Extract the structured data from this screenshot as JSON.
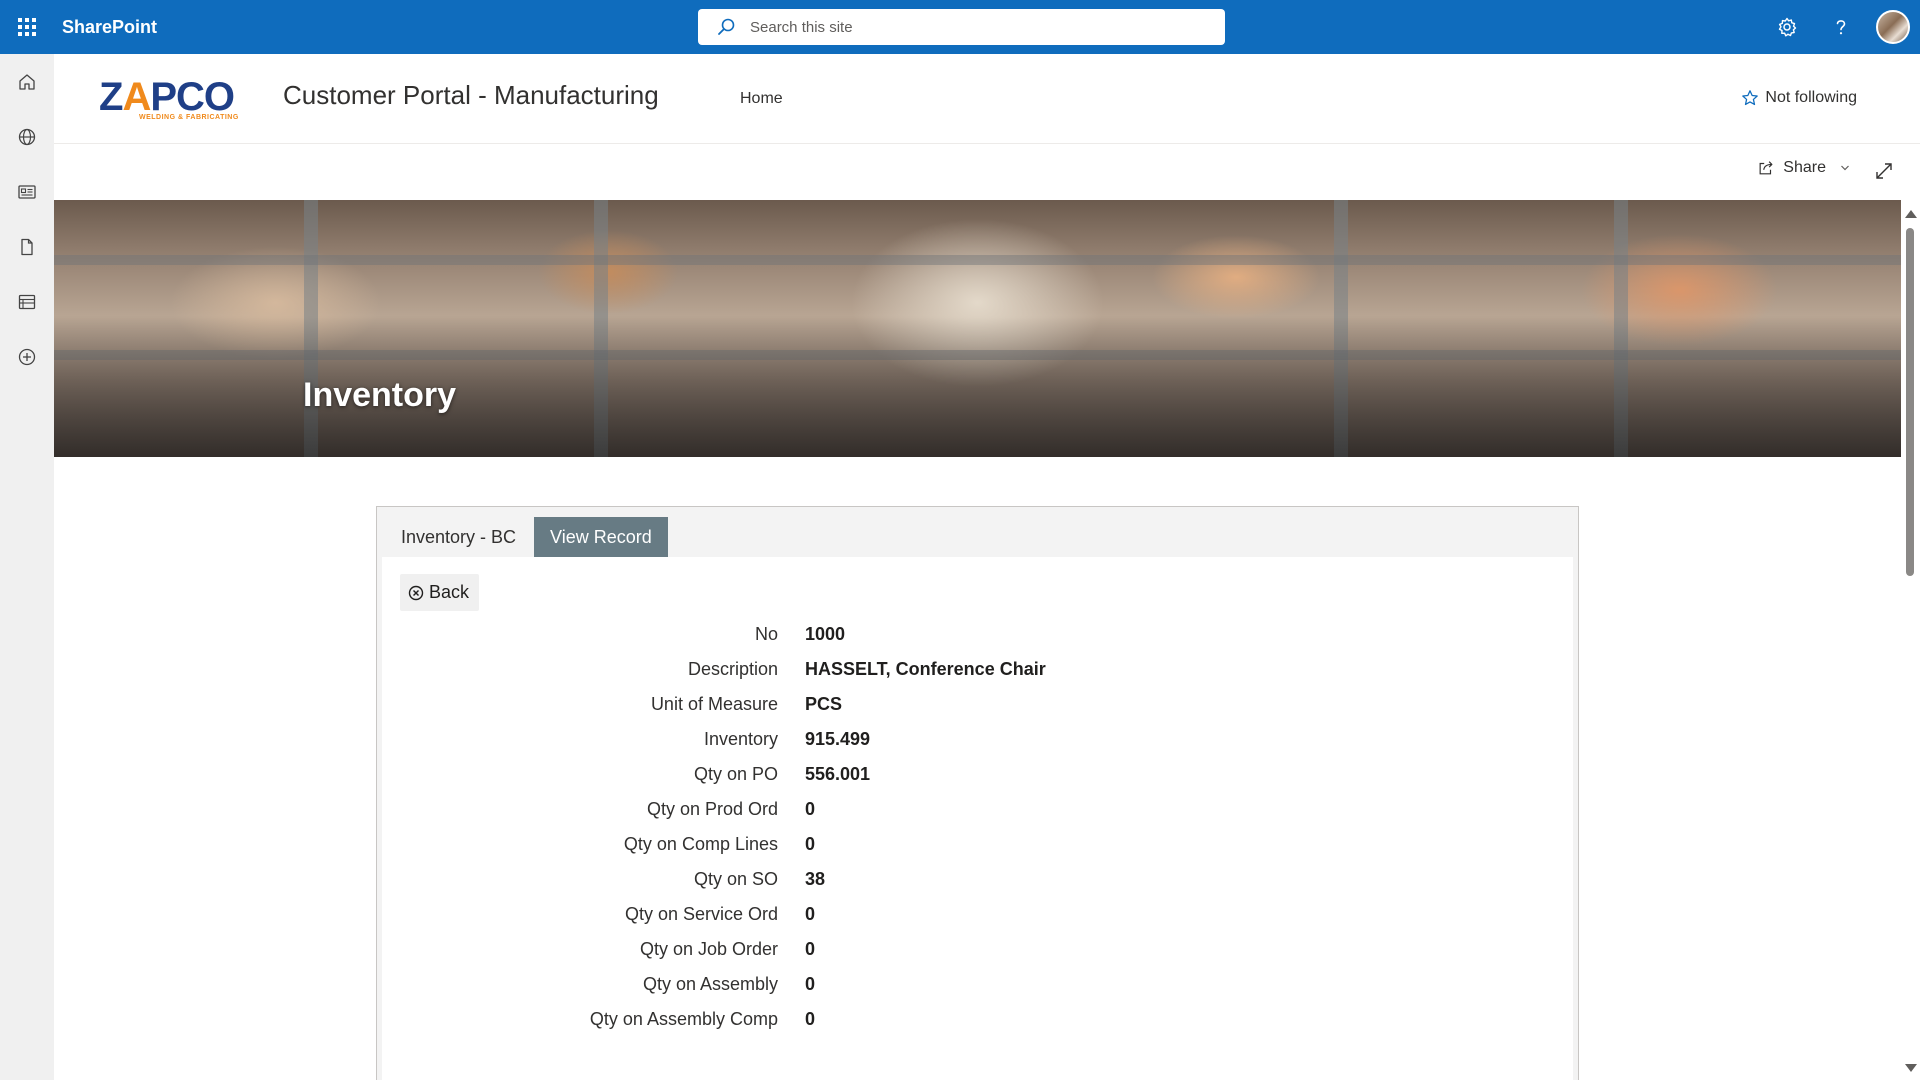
{
  "suitebar": {
    "brand": "SharePoint",
    "search_placeholder": "Search this site"
  },
  "site": {
    "logo_main": "ZAPCO",
    "logo_sub": "WELDING & FABRICATING",
    "title": "Customer Portal - Manufacturing",
    "nav": [
      {
        "label": "Home"
      }
    ],
    "follow_label": "Not following"
  },
  "commandbar": {
    "share_label": "Share"
  },
  "hero": {
    "title": "Inventory"
  },
  "record": {
    "tabs": [
      {
        "label": "Inventory - BC",
        "active": false
      },
      {
        "label": "View Record",
        "active": true
      }
    ],
    "back_label": "Back",
    "fields": [
      {
        "label": "No",
        "value": "1000"
      },
      {
        "label": "Description",
        "value": "HASSELT, Conference Chair"
      },
      {
        "label": "Unit of Measure",
        "value": "PCS"
      },
      {
        "label": "Inventory",
        "value": "915.499"
      },
      {
        "label": "Qty on PO",
        "value": "556.001"
      },
      {
        "label": "Qty on Prod Ord",
        "value": "0"
      },
      {
        "label": "Qty on Comp Lines",
        "value": "0"
      },
      {
        "label": "Qty on SO",
        "value": "38"
      },
      {
        "label": "Qty on Service Ord",
        "value": "0"
      },
      {
        "label": "Qty on Job Order",
        "value": "0"
      },
      {
        "label": "Qty on Assembly",
        "value": "0"
      },
      {
        "label": "Qty on Assembly Comp",
        "value": "0"
      }
    ]
  },
  "colors": {
    "suitebar": "#0f6cbd",
    "active_tab": "#677b84",
    "logo_blue": "#1f3f87",
    "logo_orange": "#f08a1c"
  },
  "icons": {
    "appbar": [
      "home-icon",
      "globe-icon",
      "news-icon",
      "document-icon",
      "list-icon",
      "add-circle-icon"
    ],
    "suitebar": [
      "waffle-icon",
      "search-icon",
      "settings-icon",
      "help-icon"
    ]
  }
}
